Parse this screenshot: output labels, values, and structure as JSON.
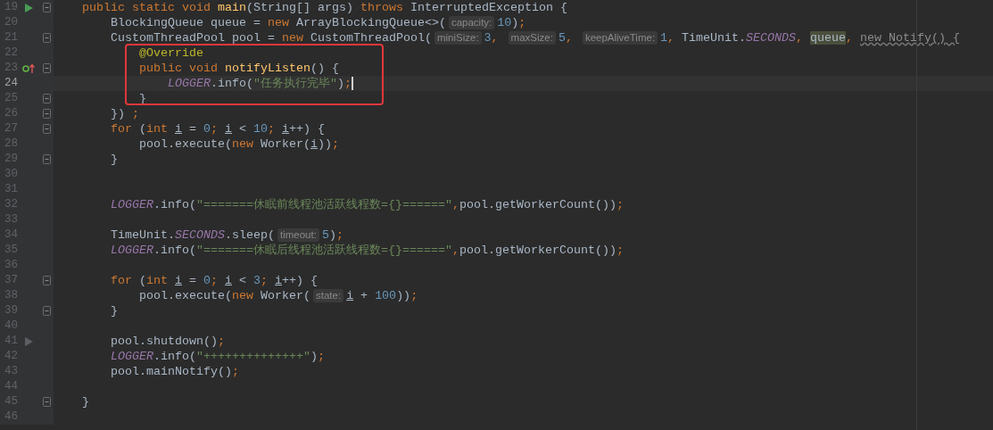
{
  "lines": [
    {
      "number": "19",
      "fold": true,
      "kind": "run",
      "current": false,
      "tokens": [
        {
          "text": "    public static void ",
          "kind": "kw"
        },
        {
          "text": "main",
          "kind": "method"
        },
        {
          "text": "(String[] args) ",
          "kind": "plain"
        },
        {
          "text": "throws ",
          "kind": "kw"
        },
        {
          "text": "InterruptedException {",
          "kind": "plain"
        }
      ]
    },
    {
      "number": "20",
      "fold": false,
      "current": false,
      "tokens": [
        {
          "text": "        BlockingQueue queue = ",
          "kind": "plain"
        },
        {
          "text": "new ",
          "kind": "kw"
        },
        {
          "text": "ArrayBlockingQueue<>(",
          "kind": "plain"
        },
        {
          "text": "capacity:",
          "kind": "hint"
        },
        {
          "text": "10",
          "kind": "num"
        },
        {
          "text": ")",
          "kind": "plain"
        },
        {
          "text": ";",
          "kind": "kw"
        }
      ]
    },
    {
      "number": "21",
      "fold": true,
      "current": false,
      "tokens": [
        {
          "text": "        CustomThreadPool pool = ",
          "kind": "plain"
        },
        {
          "text": "new ",
          "kind": "kw"
        },
        {
          "text": "CustomThreadPool(",
          "kind": "plain"
        },
        {
          "text": "miniSize:",
          "kind": "hint"
        },
        {
          "text": "3",
          "kind": "num"
        },
        {
          "text": ", ",
          "kind": "kw"
        },
        {
          "text": "maxSize:",
          "kind": "hint"
        },
        {
          "text": "5",
          "kind": "num"
        },
        {
          "text": ", ",
          "kind": "kw"
        },
        {
          "text": "keepAliveTime:",
          "kind": "hint"
        },
        {
          "text": "1",
          "kind": "num"
        },
        {
          "text": ", ",
          "kind": "kw"
        },
        {
          "text": "TimeUnit.",
          "kind": "plain"
        },
        {
          "text": "SECONDS",
          "kind": "static"
        },
        {
          "text": ", ",
          "kind": "kw"
        },
        {
          "text": "queue",
          "kind": "hl"
        },
        {
          "text": ", ",
          "kind": "kw"
        },
        {
          "text": "new Notify() {",
          "kind": "warn"
        }
      ]
    },
    {
      "number": "22",
      "fold": false,
      "current": false,
      "tokens": [
        {
          "text": "            @Override",
          "kind": "ann"
        }
      ]
    },
    {
      "number": "23",
      "fold": true,
      "kind": "override",
      "current": false,
      "tokens": [
        {
          "text": "            public void ",
          "kind": "kw"
        },
        {
          "text": "notifyListen",
          "kind": "method"
        },
        {
          "text": "() {",
          "kind": "plain"
        }
      ]
    },
    {
      "number": "24",
      "fold": false,
      "current": true,
      "tokens": [
        {
          "text": "                LOGGER",
          "kind": "static"
        },
        {
          "text": ".info(",
          "kind": "plain"
        },
        {
          "text": "\"任务执行完毕\"",
          "kind": "str"
        },
        {
          "text": ")",
          "kind": "plain"
        },
        {
          "text": ";",
          "kind": "kw"
        }
      ]
    },
    {
      "number": "25",
      "fold": true,
      "current": false,
      "tokens": [
        {
          "text": "            }",
          "kind": "plain"
        }
      ]
    },
    {
      "number": "26",
      "fold": true,
      "current": false,
      "tokens": [
        {
          "text": "        }) ",
          "kind": "plain"
        },
        {
          "text": ";",
          "kind": "kw"
        }
      ]
    },
    {
      "number": "27",
      "fold": true,
      "current": false,
      "tokens": [
        {
          "text": "        for ",
          "kind": "kw"
        },
        {
          "text": "(",
          "kind": "plain"
        },
        {
          "text": "int ",
          "kind": "kw"
        },
        {
          "text": "i",
          "kind": "var"
        },
        {
          "text": " = ",
          "kind": "plain"
        },
        {
          "text": "0",
          "kind": "num"
        },
        {
          "text": "; ",
          "kind": "kw"
        },
        {
          "text": "i",
          "kind": "var"
        },
        {
          "text": " < ",
          "kind": "plain"
        },
        {
          "text": "10",
          "kind": "num"
        },
        {
          "text": "; ",
          "kind": "kw"
        },
        {
          "text": "i",
          "kind": "var"
        },
        {
          "text": "++) {",
          "kind": "plain"
        }
      ]
    },
    {
      "number": "28",
      "fold": false,
      "current": false,
      "tokens": [
        {
          "text": "            pool.execute(",
          "kind": "plain"
        },
        {
          "text": "new ",
          "kind": "kw"
        },
        {
          "text": "Worker(",
          "kind": "plain"
        },
        {
          "text": "i",
          "kind": "var"
        },
        {
          "text": "))",
          "kind": "plain"
        },
        {
          "text": ";",
          "kind": "kw"
        }
      ]
    },
    {
      "number": "29",
      "fold": true,
      "current": false,
      "tokens": [
        {
          "text": "        }",
          "kind": "plain"
        }
      ]
    },
    {
      "number": "30",
      "fold": false,
      "current": false
    },
    {
      "number": "31",
      "fold": false,
      "current": false
    },
    {
      "number": "32",
      "fold": false,
      "current": false,
      "tokens": [
        {
          "text": "        LOGGER",
          "kind": "static"
        },
        {
          "text": ".info(",
          "kind": "plain"
        },
        {
          "text": "\"=======休眠前线程池活跃线程数={}======\"",
          "kind": "str"
        },
        {
          "text": ",",
          "kind": "kw"
        },
        {
          "text": "pool.getWorkerCount())",
          "kind": "plain"
        },
        {
          "text": ";",
          "kind": "kw"
        }
      ]
    },
    {
      "number": "33",
      "fold": false,
      "current": false
    },
    {
      "number": "34",
      "fold": false,
      "current": false,
      "tokens": [
        {
          "text": "        TimeUnit.",
          "kind": "plain"
        },
        {
          "text": "SECONDS",
          "kind": "static"
        },
        {
          "text": ".sleep(",
          "kind": "plain"
        },
        {
          "text": "timeout:",
          "kind": "hint"
        },
        {
          "text": "5",
          "kind": "num"
        },
        {
          "text": ")",
          "kind": "plain"
        },
        {
          "text": ";",
          "kind": "kw"
        }
      ]
    },
    {
      "number": "35",
      "fold": false,
      "current": false,
      "tokens": [
        {
          "text": "        LOGGER",
          "kind": "static"
        },
        {
          "text": ".info(",
          "kind": "plain"
        },
        {
          "text": "\"=======休眠后线程池活跃线程数={}======\"",
          "kind": "str"
        },
        {
          "text": ",",
          "kind": "kw"
        },
        {
          "text": "pool.getWorkerCount())",
          "kind": "plain"
        },
        {
          "text": ";",
          "kind": "kw"
        }
      ]
    },
    {
      "number": "36",
      "fold": false,
      "current": false
    },
    {
      "number": "37",
      "fold": true,
      "current": false,
      "tokens": [
        {
          "text": "        for ",
          "kind": "kw"
        },
        {
          "text": "(",
          "kind": "plain"
        },
        {
          "text": "int ",
          "kind": "kw"
        },
        {
          "text": "i",
          "kind": "var"
        },
        {
          "text": " = ",
          "kind": "plain"
        },
        {
          "text": "0",
          "kind": "num"
        },
        {
          "text": "; ",
          "kind": "kw"
        },
        {
          "text": "i",
          "kind": "var"
        },
        {
          "text": " < ",
          "kind": "plain"
        },
        {
          "text": "3",
          "kind": "num"
        },
        {
          "text": "; ",
          "kind": "kw"
        },
        {
          "text": "i",
          "kind": "var"
        },
        {
          "text": "++) {",
          "kind": "plain"
        }
      ]
    },
    {
      "number": "38",
      "fold": false,
      "current": false,
      "tokens": [
        {
          "text": "            pool.execute(",
          "kind": "plain"
        },
        {
          "text": "new ",
          "kind": "kw"
        },
        {
          "text": "Worker(",
          "kind": "plain"
        },
        {
          "text": "state:",
          "kind": "hint"
        },
        {
          "text": "i",
          "kind": "var"
        },
        {
          "text": " + ",
          "kind": "plain"
        },
        {
          "text": "100",
          "kind": "num"
        },
        {
          "text": "))",
          "kind": "plain"
        },
        {
          "text": ";",
          "kind": "kw"
        }
      ]
    },
    {
      "number": "39",
      "fold": true,
      "current": false,
      "tokens": [
        {
          "text": "        }",
          "kind": "plain"
        }
      ]
    },
    {
      "number": "40",
      "fold": false,
      "current": false
    },
    {
      "number": "41",
      "fold": false,
      "kind": "pointer",
      "current": false,
      "tokens": [
        {
          "text": "        pool.shutdown()",
          "kind": "plain"
        },
        {
          "text": ";",
          "kind": "kw"
        }
      ]
    },
    {
      "number": "42",
      "fold": false,
      "current": false,
      "tokens": [
        {
          "text": "        LOGGER",
          "kind": "static"
        },
        {
          "text": ".info(",
          "kind": "plain"
        },
        {
          "text": "\"++++++++++++++\"",
          "kind": "str"
        },
        {
          "text": ")",
          "kind": "plain"
        },
        {
          "text": ";",
          "kind": "kw"
        }
      ]
    },
    {
      "number": "43",
      "fold": false,
      "current": false,
      "tokens": [
        {
          "text": "        pool.mainNotify()",
          "kind": "plain"
        },
        {
          "text": ";",
          "kind": "kw"
        }
      ]
    },
    {
      "number": "44",
      "fold": false,
      "current": false
    },
    {
      "number": "45",
      "fold": true,
      "current": false,
      "tokens": [
        {
          "text": "    }",
          "kind": "plain"
        }
      ]
    },
    {
      "number": "46",
      "fold": false,
      "current": false
    }
  ]
}
